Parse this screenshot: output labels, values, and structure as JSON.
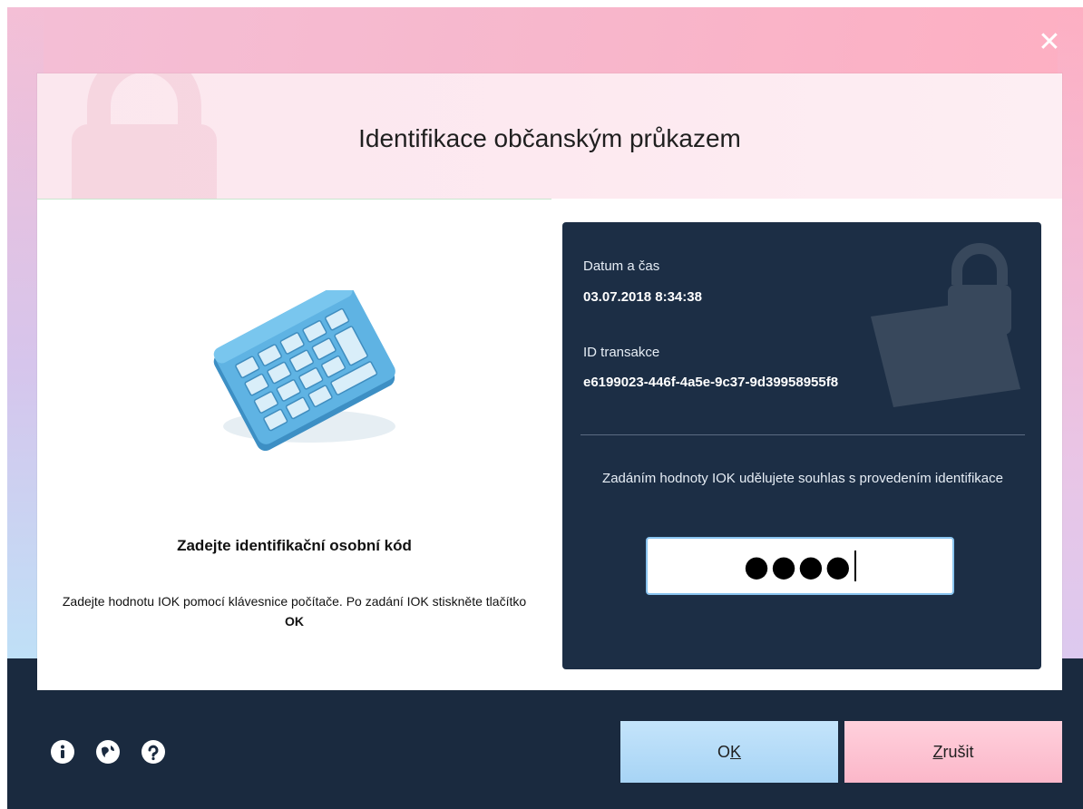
{
  "dialog": {
    "title": "Identifikace občanským průkazem",
    "close_icon": "close-icon"
  },
  "instructions": {
    "heading": "Zadejte identifikační osobní kód",
    "text_before": "Zadejte hodnotu IOK pomocí klávesnice počítače. Po zadání IOK stiskněte tlačítko",
    "text_bold": "OK"
  },
  "info": {
    "datetime_label": "Datum a čas",
    "datetime_value": "03.07.2018 8:34:38",
    "transaction_label": "ID transakce",
    "transaction_value": "e6199023-446f-4a5e-9c37-9d39958955f8",
    "consent_text": "Zadáním hodnoty IOK udělujete souhlas s provedením identifikace",
    "pin_masked": "●●●●"
  },
  "footer": {
    "icons": [
      "info-icon",
      "globe-icon",
      "help-icon"
    ],
    "ok_prefix": "O",
    "ok_underlined": "K",
    "cancel_underlined": "Z",
    "cancel_rest": "rušit"
  },
  "colors": {
    "footer_bg": "#1a2a3f",
    "info_panel_bg": "#1c2e45",
    "ok_button": "#b4dbf8",
    "cancel_button": "#fcc2d1",
    "input_border": "#89c4f0"
  }
}
